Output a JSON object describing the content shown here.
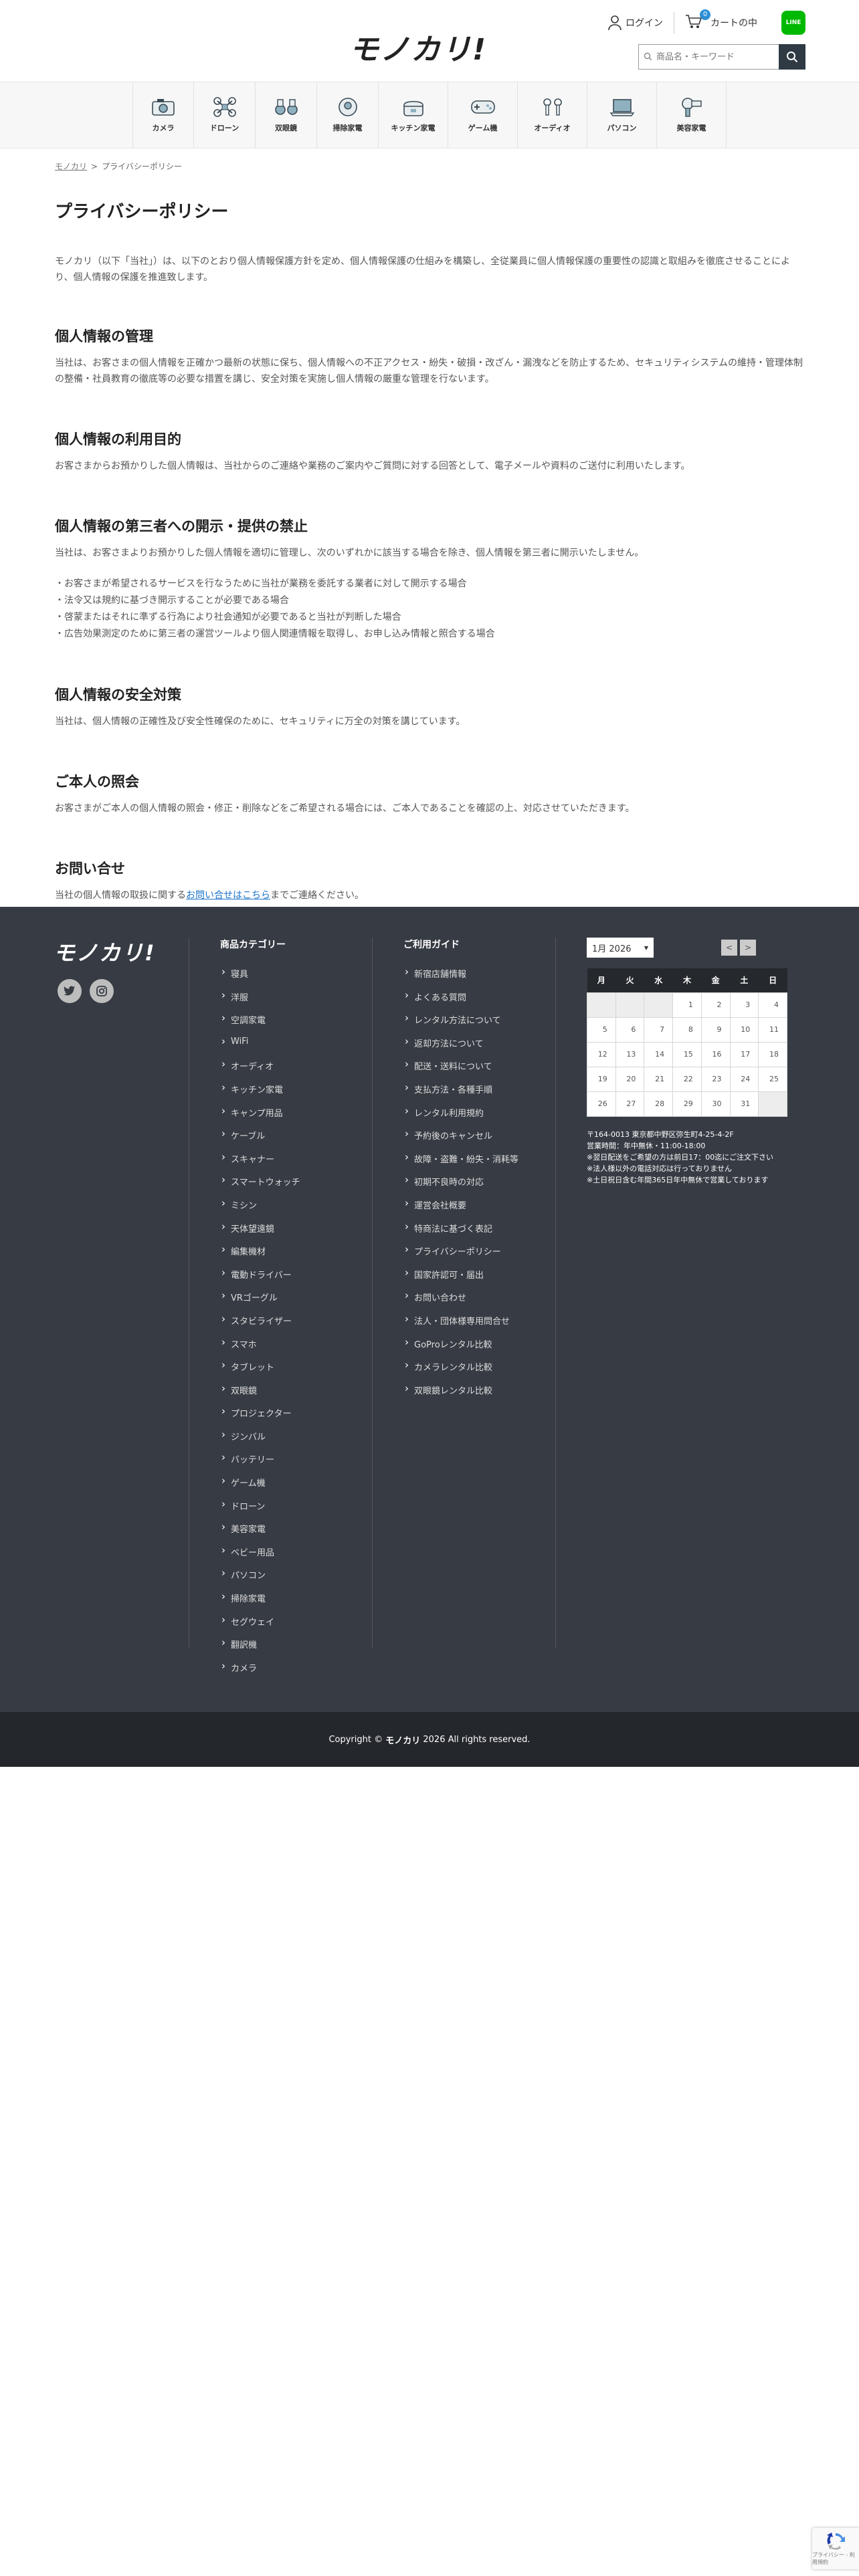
{
  "header": {
    "logo": "モノカリ!",
    "login_label": "ログイン",
    "cart_label": "カートの中",
    "cart_count": "0",
    "line_label": "LINE",
    "search_placeholder": "商品名・キーワード"
  },
  "categories": [
    {
      "label": "カメラ",
      "icon": "camera-icon"
    },
    {
      "label": "ドローン",
      "icon": "drone-icon"
    },
    {
      "label": "双眼鏡",
      "icon": "binoculars-icon"
    },
    {
      "label": "掃除家電",
      "icon": "robot-vacuum-icon"
    },
    {
      "label": "キッチン家電",
      "icon": "rice-cooker-icon"
    },
    {
      "label": "ゲーム機",
      "icon": "game-controller-icon"
    },
    {
      "label": "オーディオ",
      "icon": "earbuds-icon"
    },
    {
      "label": "パソコン",
      "icon": "laptop-icon"
    },
    {
      "label": "美容家電",
      "icon": "hair-dryer-icon"
    }
  ],
  "breadcrumb": {
    "home": "モノカリ",
    "sep": ">",
    "current": "プライバシーポリシー"
  },
  "main": {
    "title": "プライバシーポリシー",
    "intro": "モノカリ（以下「当社」）は、以下のとおり個人情報保護方針を定め、個人情報保護の仕組みを構築し、全従業員に個人情報保護の重要性の認識と取組みを徹底させることにより、個人情報の保護を推進致します。",
    "s1_title": "個人情報の管理",
    "s1_text": "当社は、お客さまの個人情報を正確かつ最新の状態に保ち、個人情報への不正アクセス・紛失・破損・改ざん・漏洩などを防止するため、セキュリティシステムの維持・管理体制の整備・社員教育の徹底等の必要な措置を講じ、安全対策を実施し個人情報の厳重な管理を行ないます。",
    "s2_title": "個人情報の利用目的",
    "s2_text": "お客さまからお預かりした個人情報は、当社からのご連絡や業務のご案内やご質問に対する回答として、電子メールや資料のご送付に利用いたします。",
    "s3_title": "個人情報の第三者への開示・提供の禁止",
    "s3_text": "当社は、お客さまよりお預かりした個人情報を適切に管理し、次のいずれかに該当する場合を除き、個人情報を第三者に開示いたしません。",
    "s3_items": [
      "・お客さまが希望されるサービスを行なうために当社が業務を委託する業者に対して開示する場合",
      "・法令又は規約に基づき開示することが必要である場合",
      "・啓蒙またはそれに準ずる行為により社会通知が必要であると当社が判断した場合",
      "・広告効果測定のために第三者の運営ツールより個人関連情報を取得し、お申し込み情報と照合する場合"
    ],
    "s4_title": "個人情報の安全対策",
    "s4_text": "当社は、個人情報の正確性及び安全性確保のために、セキュリティに万全の対策を講じています。",
    "s5_title": "ご本人の照会",
    "s5_text": "お客さまがご本人の個人情報の照会・修正・削除などをご希望される場合には、ご本人であることを確認の上、対応させていただきます。",
    "s6_title": "お問い合せ",
    "s6_text_before": "当社の個人情報の取扱に関する",
    "s6_link": "お問い合せはこちら",
    "s6_text_after": "までご連絡ください。"
  },
  "footer": {
    "logo": "モノカリ!",
    "social_icons": [
      "twitter-icon",
      "instagram-icon"
    ],
    "col1_title": "商品カテゴリー",
    "col1_items": [
      "寝具",
      "洋服",
      "空調家電",
      "WiFi",
      "オーディオ",
      "キッチン家電",
      "キャンプ用品",
      "ケーブル",
      "スキャナー",
      "スマートウォッチ",
      "ミシン",
      "天体望遠鏡",
      "編集機材",
      "電動ドライバー",
      "VRゴーグル",
      "スタビライザー",
      "スマホ",
      "タブレット",
      "双眼鏡",
      "プロジェクター",
      "ジンバル",
      "バッテリー",
      "ゲーム機",
      "ドローン",
      "美容家電",
      "ベビー用品",
      "パソコン",
      "掃除家電",
      "セグウェイ",
      "翻訳機",
      "カメラ"
    ],
    "col2_title": "ご利用ガイド",
    "col2_items": [
      "新宿店舗情報",
      "よくある質問",
      "レンタル方法について",
      "返却方法について",
      "配送・送料について",
      "支払方法・各種手順",
      "レンタル利用規約",
      "予約後のキャンセル",
      "故障・盗難・紛失・消耗等",
      "初期不良時の対応",
      "運営会社概要",
      "特商法に基づく表記",
      "プライバシーポリシー",
      "国家許認可・届出",
      "お問い合わせ",
      "法人・団体様専用問合せ",
      "GoProレンタル比較",
      "カメラレンタル比較",
      "双眼鏡レンタル比較"
    ],
    "calendar": {
      "month_label": "1月 2026",
      "prev": "<",
      "next": ">",
      "weekdays": [
        "月",
        "火",
        "水",
        "木",
        "金",
        "土",
        "日"
      ],
      "weeks": [
        [
          "",
          "",
          "",
          "1",
          "2",
          "3",
          "4"
        ],
        [
          "5",
          "6",
          "7",
          "8",
          "9",
          "10",
          "11"
        ],
        [
          "12",
          "13",
          "14",
          "15",
          "16",
          "17",
          "18"
        ],
        [
          "19",
          "20",
          "21",
          "22",
          "23",
          "24",
          "25"
        ],
        [
          "26",
          "27",
          "28",
          "29",
          "30",
          "31",
          ""
        ]
      ],
      "info": [
        "〒164-0013 東京都中野区弥生町4-25-4-2F",
        "営業時間：年中無休・11:00-18:00",
        "※翌日配送をご希望の方は前日17：00迄にご注文下さい",
        "※法人様以外の電話対応は行っておりません",
        "※土日祝日含む年間365日年中無休で営業しております"
      ]
    },
    "copyright_before": "Copyright ©",
    "copyright_brand": "モノカリ",
    "copyright_after": "2026 All rights reserved."
  },
  "recaptcha": {
    "label": "プライバシー - 利用規約"
  }
}
